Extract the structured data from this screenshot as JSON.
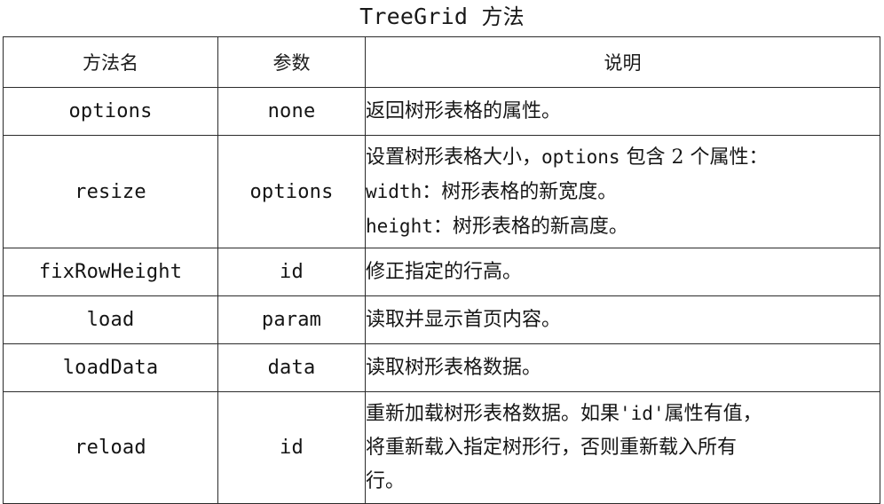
{
  "title": {
    "mono_part": "TreeGrid",
    "cjk_part": "方法",
    "full": "TreeGrid 方法"
  },
  "table": {
    "columns": [
      {
        "key": "method",
        "label": "方法名"
      },
      {
        "key": "param",
        "label": "参数"
      },
      {
        "key": "desc",
        "label": "说明"
      }
    ],
    "rows": [
      {
        "method": "options",
        "param": "none",
        "desc_lines": [
          [
            {
              "t": "返回树形表格的属性。",
              "mono": false
            }
          ]
        ]
      },
      {
        "method": "resize",
        "param": "options",
        "desc_lines": [
          [
            {
              "t": "设置树形表格大小，",
              "mono": false
            },
            {
              "t": "options",
              "mono": true
            },
            {
              "t": " 包含 2 个属性：",
              "mono": false
            }
          ],
          [
            {
              "t": "width",
              "mono": true
            },
            {
              "t": "：树形表格的新宽度。",
              "mono": false
            }
          ],
          [
            {
              "t": "height",
              "mono": true
            },
            {
              "t": "：树形表格的新高度。",
              "mono": false
            }
          ]
        ]
      },
      {
        "method": "fixRowHeight",
        "param": "id",
        "desc_lines": [
          [
            {
              "t": "修正指定的行高。",
              "mono": false
            }
          ]
        ]
      },
      {
        "method": "load",
        "param": "param",
        "desc_lines": [
          [
            {
              "t": "读取并显示首页内容。",
              "mono": false
            }
          ]
        ]
      },
      {
        "method": "loadData",
        "param": "data",
        "desc_lines": [
          [
            {
              "t": "读取树形表格数据。",
              "mono": false
            }
          ]
        ]
      },
      {
        "method": "reload",
        "param": "id",
        "desc_lines": [
          [
            {
              "t": "重新加载树形表格数据。如果",
              "mono": false
            },
            {
              "t": "'id'",
              "mono": true
            },
            {
              "t": "属性有值，",
              "mono": false
            }
          ],
          [
            {
              "t": "将重新载入指定树形行，否则重新载入所有",
              "mono": false
            }
          ],
          [
            {
              "t": "行。",
              "mono": false
            }
          ]
        ]
      }
    ]
  },
  "colors": {
    "border": "#2b2b2b",
    "text": "#161616",
    "background": "#ffffff"
  }
}
